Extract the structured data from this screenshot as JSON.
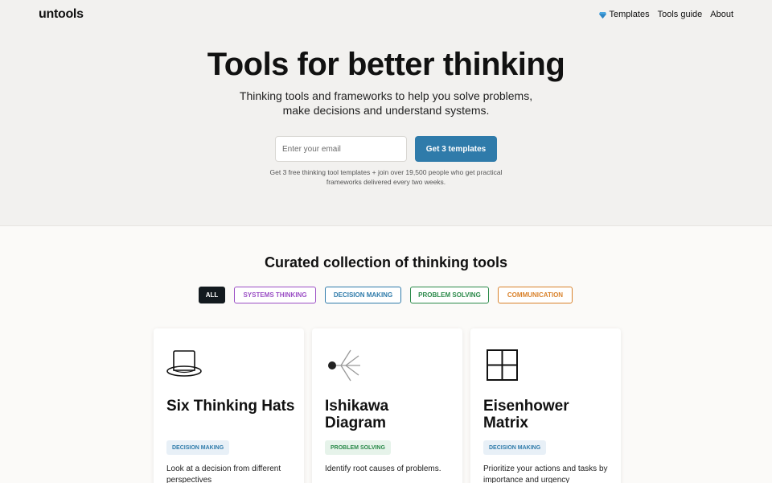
{
  "header": {
    "logo": "untools",
    "nav": [
      {
        "label": "Templates",
        "icon": "gem-icon"
      },
      {
        "label": "Tools guide"
      },
      {
        "label": "About"
      }
    ]
  },
  "hero": {
    "title": "Tools for better thinking",
    "subtitle": "Thinking tools and frameworks to help you solve problems, make decisions and understand systems.",
    "email_placeholder": "Enter your email",
    "cta_label": "Get 3 templates",
    "note": "Get 3 free thinking tool templates + join over 19,500 people who get practical frameworks delivered every two weeks."
  },
  "collection": {
    "title": "Curated collection of thinking tools",
    "filters": [
      "ALL",
      "SYSTEMS THINKING",
      "DECISION MAKING",
      "PROBLEM SOLVING",
      "COMMUNICATION"
    ],
    "cards": [
      {
        "title": "Six Thinking Hats",
        "tag": "DECISION MAKING",
        "description": "Look at a decision from different perspectives",
        "icon": "hat-icon"
      },
      {
        "title": "Ishikawa Diagram",
        "tag": "PROBLEM SOLVING",
        "description": "Identify root causes of problems.",
        "icon": "fishbone-icon"
      },
      {
        "title": "Eisenhower Matrix",
        "tag": "DECISION MAKING",
        "description": "Prioritize your actions and tasks by importance and urgency",
        "icon": "matrix-icon"
      }
    ]
  },
  "colors": {
    "accent": "#2f7baa",
    "systems_thinking": "#9b4fc5",
    "decision_making": "#2f7baa",
    "problem_solving": "#2b8a4a",
    "communication": "#d9822b"
  }
}
